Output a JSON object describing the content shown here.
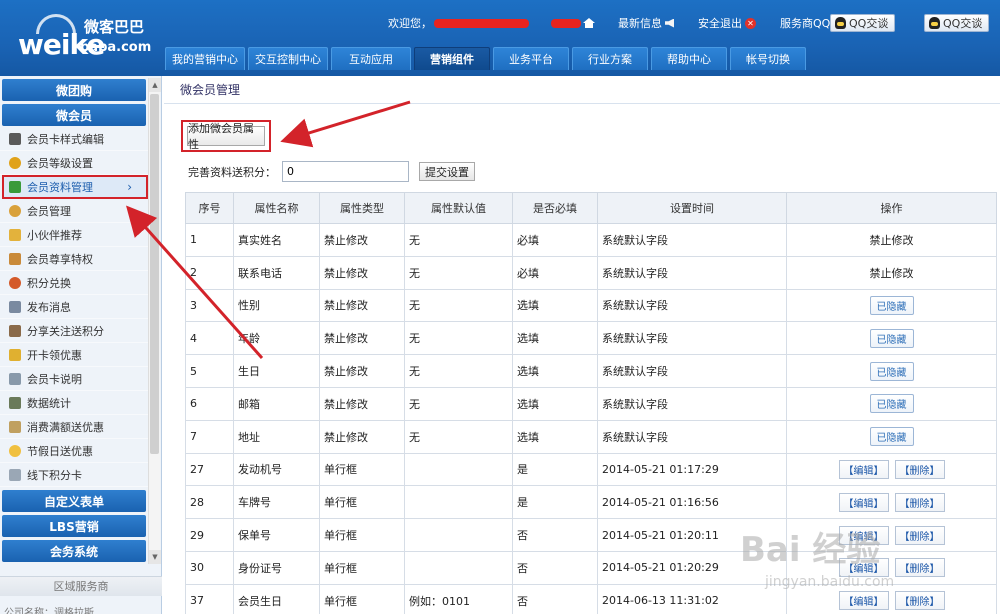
{
  "header": {
    "logo_main": "weike",
    "logo_sub": "baba.com",
    "logo_cn": "微客巴巴",
    "welcome": "欢迎您，",
    "latest_news": "最新信息",
    "logout": "安全退出",
    "service_qq": "服务商QQ：",
    "qq_btn1": "QQ交谈",
    "qq_btn2": "QQ交谈"
  },
  "nav": {
    "tabs": [
      {
        "label": "我的营销中心"
      },
      {
        "label": "交互控制中心"
      },
      {
        "label": "互动应用"
      },
      {
        "label": "营销组件"
      },
      {
        "label": "业务平台"
      },
      {
        "label": "行业方案"
      },
      {
        "label": "帮助中心"
      },
      {
        "label": "帐号切换"
      }
    ]
  },
  "sidebar": {
    "head1": "微团购",
    "head2": "微会员",
    "items": [
      {
        "label": "会员卡样式编辑",
        "icon": "card-style-icon"
      },
      {
        "label": "会员等级设置",
        "icon": "medal-icon"
      },
      {
        "label": "会员资料管理",
        "icon": "profile-card-icon"
      },
      {
        "label": "会员管理",
        "icon": "user-icon"
      },
      {
        "label": "小伙伴推荐",
        "icon": "recommend-icon"
      },
      {
        "label": "会员尊享特权",
        "icon": "privilege-icon"
      },
      {
        "label": "积分兑换",
        "icon": "exchange-icon"
      },
      {
        "label": "发布消息",
        "icon": "message-icon"
      },
      {
        "label": "分享关注送积分",
        "icon": "share-icon"
      },
      {
        "label": "开卡领优惠",
        "icon": "open-card-icon"
      },
      {
        "label": "会员卡说明",
        "icon": "doc-icon"
      },
      {
        "label": "数据统计",
        "icon": "stats-icon"
      },
      {
        "label": "消费满额送优惠",
        "icon": "consume-icon"
      },
      {
        "label": "节假日送优惠",
        "icon": "holiday-icon"
      },
      {
        "label": "线下积分卡",
        "icon": "offline-card-icon"
      }
    ],
    "head3": "自定义表单",
    "head4": "LBS营销",
    "head5": "会务系统",
    "region": "区域服务商",
    "company": "公司名称：调格拉斯"
  },
  "main": {
    "breadcrumb": "微会员管理",
    "add_button": "添加微会员属性",
    "points_label": "完善资料送积分：",
    "points_value": "0",
    "submit_button": "提交设置",
    "columns": [
      "序号",
      "属性名称",
      "属性类型",
      "属性默认值",
      "是否必填",
      "设置时间",
      "操作"
    ],
    "rows": [
      {
        "no": "1",
        "name": "真实姓名",
        "type": "禁止修改",
        "default": "无",
        "required": "必填",
        "time": "系统默认字段",
        "op": "禁止修改",
        "op_kind": "text"
      },
      {
        "no": "2",
        "name": "联系电话",
        "type": "禁止修改",
        "default": "无",
        "required": "必填",
        "time": "系统默认字段",
        "op": "禁止修改",
        "op_kind": "text"
      },
      {
        "no": "3",
        "name": "性别",
        "type": "禁止修改",
        "default": "无",
        "required": "选填",
        "time": "系统默认字段",
        "op": "已隐藏",
        "op_kind": "hidden"
      },
      {
        "no": "4",
        "name": "年龄",
        "type": "禁止修改",
        "default": "无",
        "required": "选填",
        "time": "系统默认字段",
        "op": "已隐藏",
        "op_kind": "hidden"
      },
      {
        "no": "5",
        "name": "生日",
        "type": "禁止修改",
        "default": "无",
        "required": "选填",
        "time": "系统默认字段",
        "op": "已隐藏",
        "op_kind": "hidden"
      },
      {
        "no": "6",
        "name": "邮箱",
        "type": "禁止修改",
        "default": "无",
        "required": "选填",
        "time": "系统默认字段",
        "op": "已隐藏",
        "op_kind": "hidden"
      },
      {
        "no": "7",
        "name": "地址",
        "type": "禁止修改",
        "default": "无",
        "required": "选填",
        "time": "系统默认字段",
        "op": "已隐藏",
        "op_kind": "hidden"
      },
      {
        "no": "27",
        "name": "发动机号",
        "type": "单行框",
        "default": "",
        "required": "是",
        "time": "2014-05-21 01:17:29",
        "op_kind": "edit"
      },
      {
        "no": "28",
        "name": "车牌号",
        "type": "单行框",
        "default": "",
        "required": "是",
        "time": "2014-05-21 01:16:56",
        "op_kind": "edit"
      },
      {
        "no": "29",
        "name": "保单号",
        "type": "单行框",
        "default": "",
        "required": "否",
        "time": "2014-05-21 01:20:11",
        "op_kind": "edit"
      },
      {
        "no": "30",
        "name": "身份证号",
        "type": "单行框",
        "default": "",
        "required": "否",
        "time": "2014-05-21 01:20:29",
        "op_kind": "edit"
      },
      {
        "no": "37",
        "name": "会员生日",
        "type": "单行框",
        "default": "例如：0101",
        "required": "否",
        "time": "2014-06-13 11:31:02",
        "op_kind": "edit"
      }
    ],
    "edit_label": "【编辑】",
    "delete_label": "【删除】"
  },
  "watermark": {
    "text": "Bai 经验",
    "sub": "jingyan.baidu.com"
  },
  "colors": {
    "header_blue": "#1a63b4",
    "highlight_red": "#d3232a",
    "link_blue": "#1b56a8"
  }
}
